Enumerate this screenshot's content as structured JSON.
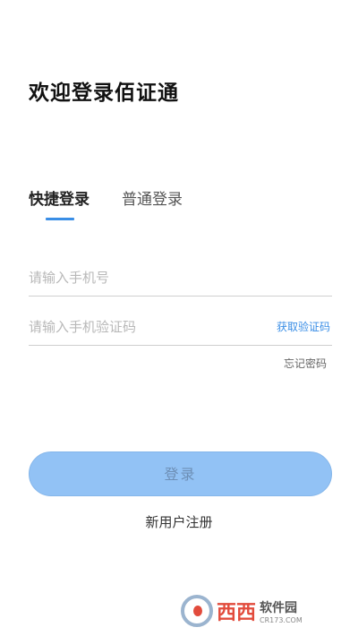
{
  "header": {
    "title": "欢迎登录佰证通"
  },
  "tabs": [
    {
      "label": "快捷登录",
      "active": true
    },
    {
      "label": "普通登录",
      "active": false
    }
  ],
  "form": {
    "phone_placeholder": "请输入手机号",
    "code_placeholder": "请输入手机验证码",
    "get_code_label": "获取验证码",
    "forgot_label": "忘记密码"
  },
  "actions": {
    "login_label": "登录",
    "register_label": "新用户注册"
  },
  "watermark": {
    "brand": "西西",
    "sub1": "软件园",
    "sub2": "CR173.COM"
  },
  "colors": {
    "accent": "#3a8ee6",
    "button_bg": "#92c2f5"
  }
}
